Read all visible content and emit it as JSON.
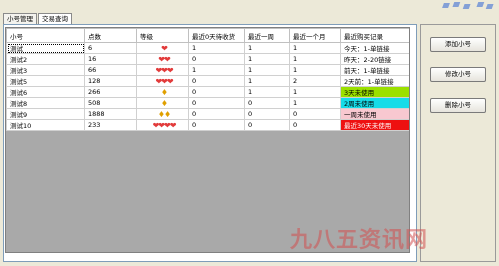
{
  "tabs": [
    {
      "label": "小号管理",
      "active": false
    },
    {
      "label": "交易查询",
      "active": true
    }
  ],
  "table": {
    "columns": [
      "小号",
      "点数",
      "等级",
      "最近0天待收货",
      "最近一周",
      "最近一个月",
      "最近购买记录"
    ],
    "rows": [
      {
        "name": "测试",
        "points": "6",
        "level": "❤",
        "level_gold": false,
        "d0": "1",
        "week": "1",
        "month": "1",
        "record": "今天：1-单链接",
        "record_bg": "#ffffff",
        "record_fg": "#000000"
      },
      {
        "name": "测试2",
        "points": "16",
        "level": "❤❤",
        "level_gold": false,
        "d0": "0",
        "week": "1",
        "month": "1",
        "record": "昨天：2-20链接",
        "record_bg": "#ffffff",
        "record_fg": "#000000"
      },
      {
        "name": "测试3",
        "points": "66",
        "level": "❤❤❤",
        "level_gold": false,
        "d0": "1",
        "week": "1",
        "month": "1",
        "record": "前天：1-单链接",
        "record_bg": "#ffffff",
        "record_fg": "#000000"
      },
      {
        "name": "测试5",
        "points": "128",
        "level": "❤❤❤",
        "level_gold": false,
        "d0": "0",
        "week": "1",
        "month": "2",
        "record": "2天前：1-单链接",
        "record_bg": "#ffffff",
        "record_fg": "#000000"
      },
      {
        "name": "测试6",
        "points": "266",
        "level": "♦",
        "level_gold": true,
        "d0": "0",
        "week": "1",
        "month": "1",
        "record": "3天未使用",
        "record_bg": "#9be000",
        "record_fg": "#000000"
      },
      {
        "name": "测试8",
        "points": "508",
        "level": "♦",
        "level_gold": true,
        "d0": "0",
        "week": "0",
        "month": "1",
        "record": "2周未使用",
        "record_bg": "#16dce8",
        "record_fg": "#000000"
      },
      {
        "name": "测试9",
        "points": "1888",
        "level": "♦♦",
        "level_gold": true,
        "d0": "0",
        "week": "0",
        "month": "0",
        "record": "一周未使用",
        "record_bg": "#f8c8d0",
        "record_fg": "#000000"
      },
      {
        "name": "测试10",
        "points": "233",
        "level": "❤❤❤❤",
        "level_gold": false,
        "d0": "0",
        "week": "0",
        "month": "0",
        "record": "最近30天未使用",
        "record_bg": "#ee1010",
        "record_fg": "#ffffff"
      }
    ]
  },
  "buttons": {
    "add": "添加小号",
    "edit": "修改小号",
    "delete": "删除小号"
  },
  "watermark": "九八五资讯网"
}
